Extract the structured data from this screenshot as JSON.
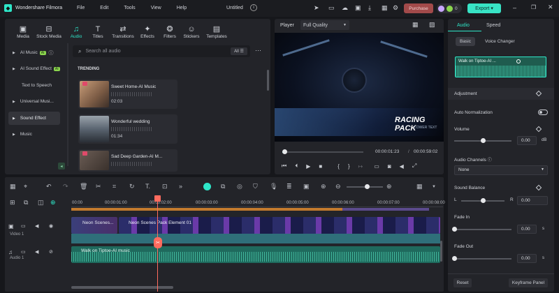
{
  "app": {
    "title": "Wondershare Filmora",
    "menu": [
      "File",
      "Edit",
      "Tools",
      "View",
      "Help"
    ],
    "project": "Untitled",
    "purchase": "Purchase",
    "export": "Export",
    "credits": "0"
  },
  "media_tabs": [
    {
      "label": "Media",
      "icon": "media-icon"
    },
    {
      "label": "Stock Media",
      "icon": "stock-media-icon"
    },
    {
      "label": "Audio",
      "icon": "audio-icon"
    },
    {
      "label": "Titles",
      "icon": "titles-icon"
    },
    {
      "label": "Transitions",
      "icon": "transitions-icon"
    },
    {
      "label": "Effects",
      "icon": "effects-icon"
    },
    {
      "label": "Filters",
      "icon": "filters-icon"
    },
    {
      "label": "Stickers",
      "icon": "stickers-icon"
    },
    {
      "label": "Templates",
      "icon": "templates-icon"
    }
  ],
  "categories": [
    {
      "label": "AI Music",
      "badge": "AI"
    },
    {
      "label": "AI Sound Effect",
      "badge": "AI"
    },
    {
      "label": "Text to Speech"
    },
    {
      "label": "Universal Musi..."
    },
    {
      "label": "Sound Effect"
    },
    {
      "label": "Music"
    }
  ],
  "search": {
    "placeholder": "Search all audio",
    "filter": "All"
  },
  "trending": {
    "heading": "TRENDING",
    "items": [
      {
        "title": "Sweet Home-AI Music",
        "duration": "02:03"
      },
      {
        "title": "Wonderful wedding",
        "duration": "01:34"
      },
      {
        "title": "Sad Deep Garden-AI M...",
        "duration": ""
      }
    ]
  },
  "player": {
    "label": "Player",
    "quality": "Full Quality",
    "overlay_title": "RACING PACK",
    "overlay_sub": "LOWER TEXT",
    "current": "00:00:01:23",
    "total": "00:00:59:02",
    "progress": 0.03
  },
  "right_panel": {
    "tabs": [
      "Audio",
      "Speed"
    ],
    "subtabs": [
      "Basic",
      "Voice Changer"
    ],
    "clip": "Walk on Tiptoe-AI ...",
    "adjustment": "Adjustment",
    "auto_norm": "Auto Normalization",
    "volume": {
      "label": "Volume",
      "value": "0.00",
      "unit": "dB",
      "level": 0.5
    },
    "channels": {
      "label": "Audio Channels",
      "value": "None"
    },
    "balance": {
      "label": "Sound Balance",
      "value": "0.00",
      "l": "L",
      "r": "R",
      "level": 0.5
    },
    "fade_in": {
      "label": "Fade In",
      "value": "0.00",
      "unit": "s"
    },
    "fade_out": {
      "label": "Fade Out",
      "value": "0.00",
      "unit": "s"
    },
    "reset": "Reset",
    "keyframe": "Keyframe Panel"
  },
  "timeline": {
    "ticks": [
      "00:00",
      "00:00:01:00",
      "00:00:02:00",
      "00:00:03:00",
      "00:00:04:00",
      "00:00:05:00",
      "00:00:06:00",
      "00:00:07:00",
      "00:00:08:00"
    ],
    "video_track": "Video 1",
    "audio_track": "Audio 1",
    "video_clips": [
      "Neon Scenes...",
      "Neon Scenes Pack Element 01"
    ],
    "audio_clip": "Walk on Tiptoe-AI music",
    "zoom": 0.55
  },
  "colors": {
    "accent": "#2ee6c8",
    "export": "#38e3c5",
    "purchase": "#a24a4a",
    "playhead": "#ff6b5e",
    "audio": "#2fa58f",
    "video": "#3a8ea6"
  }
}
